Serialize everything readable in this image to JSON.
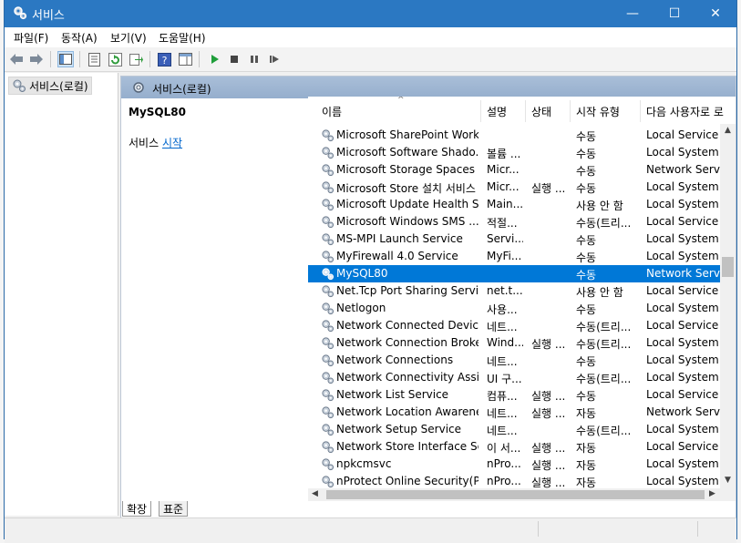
{
  "window": {
    "title": "서비스",
    "min": "—",
    "max": "☐",
    "close": "✕"
  },
  "menu": [
    "파일(F)",
    "동작(A)",
    "보기(V)",
    "도움말(H)"
  ],
  "tree": {
    "root": "서비스(로컬)"
  },
  "panel": {
    "header": "서비스(로컬)",
    "selected_name": "MySQL80",
    "action_prefix": "서비스 ",
    "action_link": "시작"
  },
  "columns": [
    "이름",
    "설명",
    "상태",
    "시작 유형",
    "다음 사용자로 로"
  ],
  "rows": [
    {
      "name": "Microsoft SharePoint Work...",
      "desc": "",
      "status": "",
      "start": "수동",
      "logon": "Local Service"
    },
    {
      "name": "Microsoft Software Shado...",
      "desc": "볼륨 ...",
      "status": "",
      "start": "수동",
      "logon": "Local System"
    },
    {
      "name": "Microsoft Storage Spaces ...",
      "desc": "Micr...",
      "status": "",
      "start": "수동",
      "logon": "Network Service"
    },
    {
      "name": "Microsoft Store 설치 서비스",
      "desc": "Micr...",
      "status": "실행 ...",
      "start": "수동",
      "logon": "Local System"
    },
    {
      "name": "Microsoft Update Health S...",
      "desc": "Main...",
      "status": "",
      "start": "사용 안 함",
      "logon": "Local System"
    },
    {
      "name": "Microsoft Windows SMS ...",
      "desc": "적절...",
      "status": "",
      "start": "수동(트리...",
      "logon": "Local Service"
    },
    {
      "name": "MS-MPI Launch Service",
      "desc": "Servi...",
      "status": "",
      "start": "수동",
      "logon": "Local System"
    },
    {
      "name": "MyFirewall 4.0 Service",
      "desc": "MyFi...",
      "status": "",
      "start": "수동",
      "logon": "Local System"
    },
    {
      "name": "MySQL80",
      "desc": "",
      "status": "",
      "start": "수동",
      "logon": "Network Service",
      "selected": true
    },
    {
      "name": "Net.Tcp Port Sharing Service",
      "desc": "net.t...",
      "status": "",
      "start": "사용 안 함",
      "logon": "Local Service"
    },
    {
      "name": "Netlogon",
      "desc": "사용...",
      "status": "",
      "start": "수동",
      "logon": "Local System"
    },
    {
      "name": "Network Connected Device...",
      "desc": "네트...",
      "status": "",
      "start": "수동(트리...",
      "logon": "Local Service"
    },
    {
      "name": "Network Connection Broker",
      "desc": "Wind...",
      "status": "실행 ...",
      "start": "수동(트리...",
      "logon": "Local System"
    },
    {
      "name": "Network Connections",
      "desc": "네트...",
      "status": "",
      "start": "수동",
      "logon": "Local System"
    },
    {
      "name": "Network Connectivity Assis...",
      "desc": "UI 구...",
      "status": "",
      "start": "수동(트리...",
      "logon": "Local System"
    },
    {
      "name": "Network List Service",
      "desc": "컴퓨...",
      "status": "실행 ...",
      "start": "수동",
      "logon": "Local Service"
    },
    {
      "name": "Network Location Awareness",
      "desc": "네트...",
      "status": "실행 ...",
      "start": "자동",
      "logon": "Network Service"
    },
    {
      "name": "Network Setup Service",
      "desc": "네트...",
      "status": "",
      "start": "수동(트리...",
      "logon": "Local System"
    },
    {
      "name": "Network Store Interface Se...",
      "desc": "이 서...",
      "status": "실행 ...",
      "start": "자동",
      "logon": "Local Service"
    },
    {
      "name": "npkcmsvc",
      "desc": "nPro...",
      "status": "실행 ...",
      "start": "자동",
      "logon": "Local System"
    },
    {
      "name": "nProtect Online Security(P...",
      "desc": "nPro...",
      "status": "실행 ...",
      "start": "자동",
      "logon": "Local System"
    }
  ],
  "tabs": [
    "확장",
    "표준"
  ],
  "colors": {
    "titlebar": "#2b78c2",
    "selection": "#0078d7",
    "link": "#0066cc"
  }
}
